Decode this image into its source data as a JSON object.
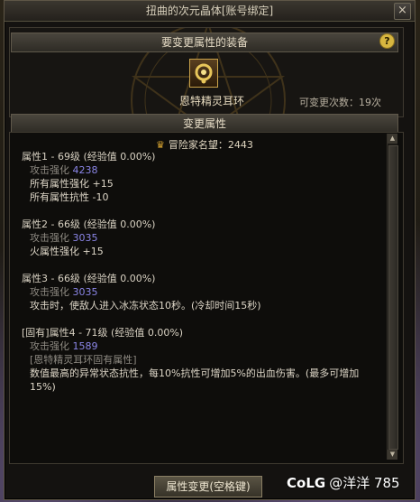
{
  "window": {
    "title": "扭曲的次元晶体[账号绑定]",
    "close_label": "×"
  },
  "equip_section": {
    "header": "要变更属性的装备",
    "help_label": "?",
    "item_name": "恩特精灵耳环",
    "changes_left": "可变更次数：19次"
  },
  "attr_section": {
    "header": "变更属性",
    "fame": "冒险家名望：2443",
    "groups": [
      {
        "title": "属性1 - 69级 (经验值 0.00%)",
        "lines": [
          {
            "label": "攻击强化",
            "value": "4238"
          },
          {
            "text": "所有属性强化 +15"
          },
          {
            "text": "所有属性抗性 -10"
          }
        ]
      },
      {
        "title": "属性2 - 66级 (经验值 0.00%)",
        "lines": [
          {
            "label": "攻击强化",
            "value": "3035"
          },
          {
            "text": "火属性强化 +15"
          }
        ]
      },
      {
        "title": "属性3 - 66级 (经验值 0.00%)",
        "lines": [
          {
            "label": "攻击强化",
            "value": "3035"
          },
          {
            "text": "攻击时，使敌人进入冰冻状态10秒。(冷却时间15秒)"
          }
        ]
      },
      {
        "title": "[固有]属性4 - 71级 (经验值 0.00%)",
        "lines": [
          {
            "label": "攻击强化",
            "value": "1589"
          },
          {
            "note": "[恩特精灵耳环固有属性]"
          },
          {
            "desc": "数值最高的异常状态抗性，每10%抗性可增加5%的出血伤害。(最多可增加15%)"
          }
        ]
      }
    ]
  },
  "footer": {
    "change_button": "属性变更(空格键)"
  },
  "watermark": {
    "brand": "CoLG",
    "user": "@洋洋 785"
  },
  "colors": {
    "accent_gold": "#d7b640",
    "value_purple": "#8b86e8",
    "panel_bg": "#0e0d0b"
  }
}
